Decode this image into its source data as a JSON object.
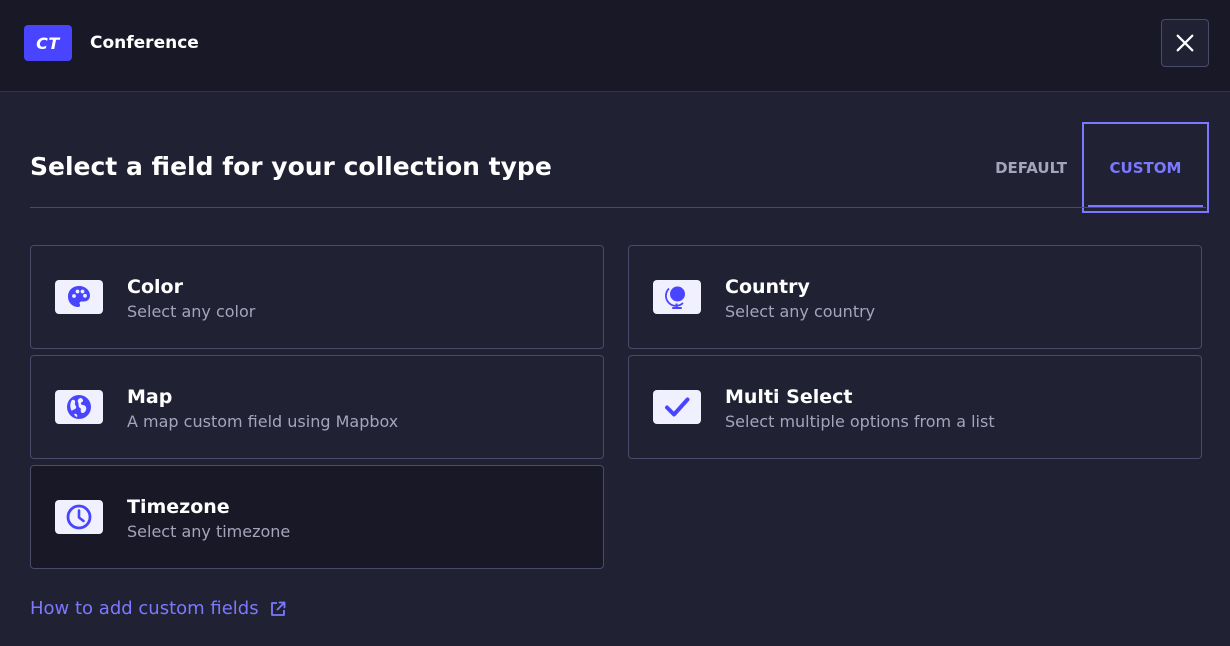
{
  "header": {
    "badge": "CT",
    "app_title": "Conference"
  },
  "main": {
    "title": "Select a field for your collection type",
    "tabs": [
      {
        "label": "DEFAULT",
        "selected": false
      },
      {
        "label": "CUSTOM",
        "selected": true
      }
    ],
    "fields": [
      {
        "title": "Color",
        "description": "Select any color",
        "icon": "palette-icon"
      },
      {
        "title": "Country",
        "description": "Select any country",
        "icon": "globe-stand-icon"
      },
      {
        "title": "Map",
        "description": "A map custom field using Mapbox",
        "icon": "earth-icon"
      },
      {
        "title": "Multi Select",
        "description": "Select multiple options from a list",
        "icon": "checkmark-icon"
      },
      {
        "title": "Timezone",
        "description": "Select any timezone",
        "icon": "clock-icon"
      }
    ],
    "help_link": "How to add custom fields"
  },
  "colors": {
    "accent": "#4945ff",
    "accent_light": "#7b79ff",
    "background": "#212134",
    "header_bg": "#181826"
  }
}
